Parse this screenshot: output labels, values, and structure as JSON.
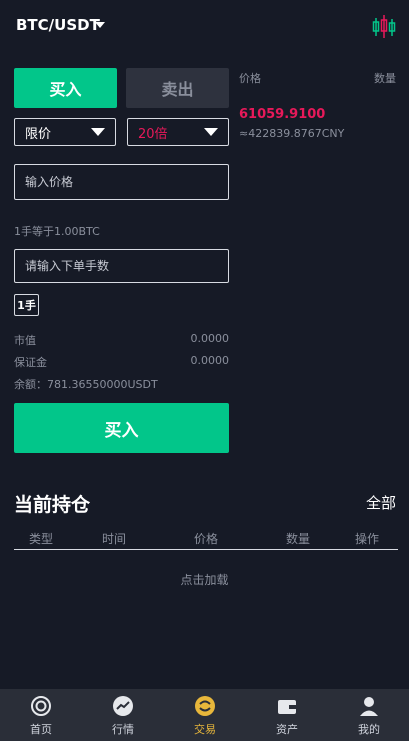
{
  "header": {
    "pair": "BTC/USDT",
    "kline_icon": "candlestick-chart-icon"
  },
  "trade": {
    "buy_tab": "买入",
    "sell_tab": "卖出",
    "order_type": "限价",
    "leverage": "20倍",
    "price_placeholder": "输入价格",
    "lot_info": "1手等于1.00BTC",
    "lots_placeholder": "请输入下单手数",
    "lot_option": "1手",
    "market_value_label": "市值",
    "market_value": "0.0000",
    "margin_label": "保证金",
    "margin": "0.0000",
    "balance": "余额：781.36550000USDT",
    "submit": "买入"
  },
  "orderbook": {
    "price_header": "价格",
    "qty_header": "数量",
    "last_price": "61059.9100",
    "cny_price": "≈422839.8767CNY"
  },
  "positions": {
    "title": "当前持仓",
    "all": "全部",
    "columns": [
      "类型",
      "时间",
      "价格",
      "数量",
      "操作"
    ],
    "load_more": "点击加载"
  },
  "nav": [
    {
      "label": "首页",
      "icon": "home-icon",
      "active": false
    },
    {
      "label": "行情",
      "icon": "market-trend-icon",
      "active": false
    },
    {
      "label": "交易",
      "icon": "trade-icon",
      "active": true
    },
    {
      "label": "资产",
      "icon": "wallet-icon",
      "active": false
    },
    {
      "label": "我的",
      "icon": "user-icon",
      "active": false
    }
  ],
  "colors": {
    "buy": "#02c68a",
    "price": "#e8195a",
    "leverage": "#e8195a",
    "active_nav": "#e8b73b",
    "background": "#161a26"
  }
}
